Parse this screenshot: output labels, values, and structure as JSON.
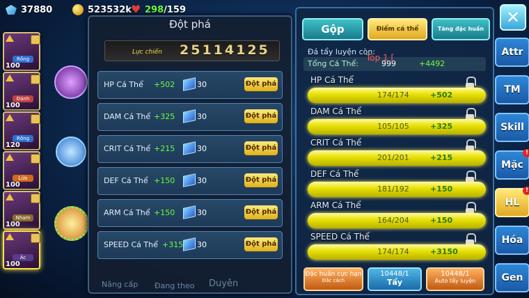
{
  "resources": {
    "gems": "37880",
    "gold": "523532k",
    "stamina_current": "298",
    "stamina_max": "/159"
  },
  "team": [
    {
      "level": "100",
      "type": "Rồng",
      "badge": "4"
    },
    {
      "level": "100",
      "type": "Đánh",
      "badge": "2"
    },
    {
      "level": "120",
      "type": "Rồng",
      "badge": "1"
    },
    {
      "level": "100",
      "type": "Lửa",
      "badge": "4"
    },
    {
      "level": "100",
      "type": "Nham",
      "badge": "4"
    },
    {
      "level": "100",
      "type": "Ác",
      "badge": "4"
    }
  ],
  "panel": {
    "title": "Đột phá",
    "power_label": "Lực chiến",
    "power_value": "25114125",
    "rows": [
      {
        "name": "HP Cá Thể",
        "plus": "+502",
        "count": "30",
        "button": "Đột phá"
      },
      {
        "name": "DAM Cá Thể",
        "plus": "+325",
        "count": "30",
        "button": "Đột phá"
      },
      {
        "name": "CRIT Cá Thể",
        "plus": "+215",
        "count": "30",
        "button": "Đột phá"
      },
      {
        "name": "DEF Cá Thể",
        "plus": "+150",
        "count": "30",
        "button": "Đột phá"
      },
      {
        "name": "ARM Cá Thể",
        "plus": "+150",
        "count": "30",
        "button": "Đột phá"
      },
      {
        "name": "SPEED Cá Thể",
        "plus": "+3150",
        "count": "30",
        "button": "Đột phá"
      }
    ],
    "bottom_nav": [
      "Nâng cấp",
      "Đang theo",
      "Duyên"
    ]
  },
  "right": {
    "tabs": [
      "Gộp",
      "Điểm cá thể",
      "Tăng đặc huấn"
    ],
    "remaining_label": "Đá tẩy luyện còn:",
    "top_label": "Top 1 [",
    "total_label": "Tổng Cá Thể:",
    "total_value": "999",
    "total_plus": "+4492",
    "stats": [
      {
        "label": "HP Cá Thể",
        "value": "174/174",
        "plus": "+502"
      },
      {
        "label": "DAM Cá Thể",
        "value": "105/105",
        "plus": "+325"
      },
      {
        "label": "CRIT Cá Thể",
        "value": "201/201",
        "plus": "+215"
      },
      {
        "label": "DEF Cá Thể",
        "value": "181/192",
        "plus": "+150"
      },
      {
        "label": "ARM Cá Thể",
        "value": "164/204",
        "plus": "+150"
      },
      {
        "label": "SPEED Cá Thể",
        "value": "174/174",
        "plus": "+3150"
      }
    ],
    "buttons": {
      "special": "Đặc huấn cực hạn",
      "special_sub": "Đắc cách",
      "wash_count": "10448/1",
      "wash": "Tẩy",
      "auto_count": "10448/1",
      "auto": "Auto tẩy luyện"
    }
  },
  "side_tabs": [
    "Attr",
    "TM",
    "Skill",
    "Mặc",
    "HL",
    "Hóa",
    "Gen"
  ],
  "close_icon": "close-x-icon"
}
